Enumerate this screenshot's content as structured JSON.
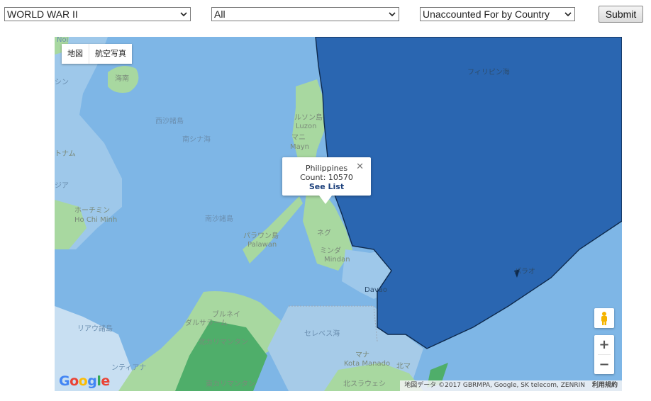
{
  "filters": {
    "conflict": "WORLD WAR II",
    "branch": "All",
    "report": "Unaccounted For by Country",
    "submit_label": "Submit"
  },
  "map": {
    "map_type_buttons": [
      "地図",
      "航空写真"
    ],
    "labels": {
      "philippine_sea": "フィリピン海",
      "south_china_sea": "南シナ海",
      "hainan": "海南",
      "paracel": "西沙諸島",
      "spratly": "南沙諸島",
      "palawan_jp": "パラワン島",
      "palawan_en": "Palawan",
      "luzon_jp": "ルソン島",
      "luzon_en": "Luzon",
      "manila_jp": "マニ",
      "manila_en": "Mayn",
      "vietnam": "トナム",
      "hcm_jp": "ホーチミン",
      "hcm_en": "Ho Chi Minh",
      "mindanao_jp": "ミンダ",
      "mindanao_en": "Mindan",
      "negros": "ネグ",
      "davao": "Davao",
      "palau": "パラオ",
      "brunei": "ブルネイ",
      "dalussalam": "ダルサラーム",
      "north_kalimantan": "北カリマンタン",
      "east_kalimantan": "東カリマンタン",
      "north_sulawesi": "北スラウェシ",
      "celebes_sea": "セレベス海",
      "kota_manado": "Kota Manado",
      "manado": "マナ",
      "north_maluku": "北マ",
      "riau": "リアウ諸島",
      "sian": "シン",
      "gia": "ジア",
      "noi": "Noi",
      "pontianak": "ンティアナ",
      "anabas": "アナンバス"
    },
    "popup": {
      "country": "Philippines",
      "count_text": "Count: 10570",
      "link_label": "See List",
      "close_glyph": "✕"
    },
    "zoom_in": "+",
    "zoom_out": "−",
    "google_logo": "Google",
    "attribution": "地図データ ©2017 GBRMPA, Google, SK telecom, ZENRIN",
    "terms": "利用規約"
  },
  "colors": {
    "highlight_dark": "#2a66b1",
    "highlight_light": "#6aa8de",
    "ocean": "#7eb6e6",
    "land_green": "#a8d8a0"
  }
}
